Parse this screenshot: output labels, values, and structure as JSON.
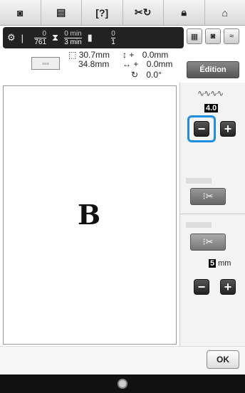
{
  "toolbar": {
    "items": [
      {
        "name": "camera-icon",
        "glyph": "◙"
      },
      {
        "name": "page-icon",
        "glyph": "▤"
      },
      {
        "name": "help-icon",
        "glyph": "[?]"
      },
      {
        "name": "stitch-icon",
        "glyph": "₵Ͽ"
      },
      {
        "name": "lock-icon",
        "glyph": "🔒"
      },
      {
        "name": "home-icon",
        "glyph": "⌂"
      }
    ]
  },
  "status": {
    "stitch_num": "0",
    "stitch_den": "761",
    "time_num": "0",
    "time_num_unit": "min",
    "time_den": "3",
    "time_den_unit": "min",
    "color_num": "0",
    "color_den": "1"
  },
  "info": {
    "width": "30.7mm",
    "height": "34.8mm",
    "offset_y": "0.0mm",
    "offset_x": "0.0mm",
    "angle": "0.0°"
  },
  "edition_label": "Édition",
  "canvas": {
    "letter": "B"
  },
  "panel": {
    "density_value": "4.0",
    "minus": "−",
    "plus": "+",
    "distance_value": "5",
    "distance_unit": "mm"
  },
  "ok_label": "OK"
}
